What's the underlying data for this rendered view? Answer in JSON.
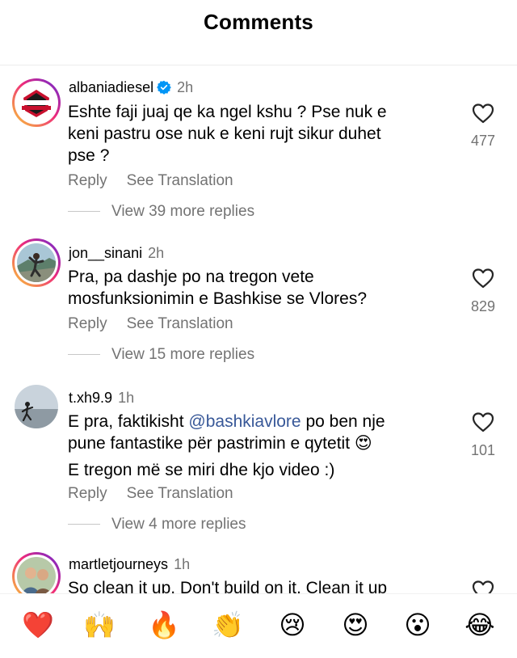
{
  "header": {
    "title": "Comments"
  },
  "comments": [
    {
      "username": "albaniadiesel",
      "verified": true,
      "time": "2h",
      "lines": [
        "Eshte faji juaj qe ka ngel kshu ? Pse nuk e",
        "keni pastru ose nuk e keni rujt sikur duhet",
        "pse ?"
      ],
      "likes": "477",
      "reply_label": "Reply",
      "translate_label": "See Translation",
      "view_replies": "View 39 more replies",
      "avatar_text": "ALBANIA DIESEL"
    },
    {
      "username": "jon__sinani",
      "verified": false,
      "time": "2h",
      "lines": [
        "Pra, pa dashje po na tregon vete",
        "mosfunksionimin e Bashkise se Vlores?"
      ],
      "likes": "829",
      "reply_label": "Reply",
      "translate_label": "See Translation",
      "view_replies": "View 15 more replies"
    },
    {
      "username": "t.xh9.9",
      "verified": false,
      "time": "1h",
      "line1_pre": "E pra, faktikisht ",
      "mention": "@bashkiavlore",
      "line1_post": " po ben nje",
      "line2": "pune fantastike për pastrimin e qytetit 😍",
      "line3": "E tregon më se miri dhe kjo video :)",
      "likes": "101",
      "reply_label": "Reply",
      "translate_label": "See Translation",
      "view_replies": "View 4 more replies"
    },
    {
      "username": "martletjourneys",
      "verified": false,
      "time": "1h",
      "lines": [
        "So clean it up. Don't build on it. Clean it up"
      ]
    }
  ],
  "reactions": [
    {
      "emoji": "❤️",
      "name": "red-heart"
    },
    {
      "emoji": "🙌",
      "name": "raising-hands"
    },
    {
      "emoji": "🔥",
      "name": "fire"
    },
    {
      "emoji": "👏",
      "name": "clapping-hands"
    },
    {
      "emoji": "😢",
      "name": "crying-face"
    },
    {
      "emoji": "😍",
      "name": "heart-eyes"
    },
    {
      "emoji": "😮",
      "name": "surprised-face"
    },
    {
      "emoji": "😂",
      "name": "tears-of-joy"
    }
  ]
}
